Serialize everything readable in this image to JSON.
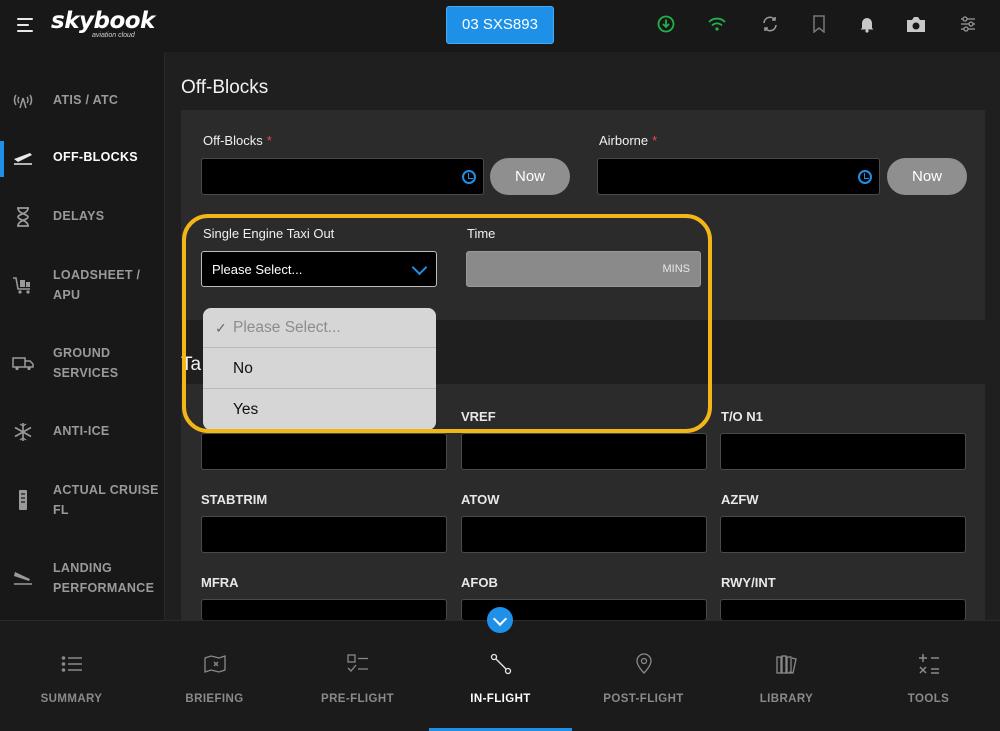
{
  "header": {
    "logo": "skybook",
    "logo_sub": "aviation cloud",
    "flight_id": "03 SXS893",
    "status_colors": {
      "download": "#22b04a",
      "wifi": "#22b04a"
    }
  },
  "sidebar": {
    "items": [
      {
        "label": "ATIS / ATC",
        "icon": "antenna-icon"
      },
      {
        "label": "OFF-BLOCKS",
        "icon": "takeoff-icon",
        "active": true
      },
      {
        "label": "DELAYS",
        "icon": "hourglass-icon"
      },
      {
        "label": "LOADSHEET / APU",
        "icon": "cart-icon"
      },
      {
        "label": "GROUND SERVICES",
        "icon": "truck-icon"
      },
      {
        "label": "ANTI-ICE",
        "icon": "snowflake-icon"
      },
      {
        "label": "ACTUAL CRUISE FL",
        "icon": "gauge-icon"
      },
      {
        "label": "LANDING PERFORMANCE",
        "icon": "landing-icon"
      }
    ]
  },
  "main": {
    "title": "Off-Blocks",
    "off_blocks": {
      "label": "Off-Blocks",
      "required": "*",
      "value": "",
      "now_label": "Now"
    },
    "airborne": {
      "label": "Airborne",
      "required": "*",
      "value": "",
      "now_label": "Now"
    },
    "taxi_out": {
      "label": "Single Engine Taxi Out",
      "value": "Please Select..."
    },
    "time": {
      "label": "Time",
      "unit": "MINS",
      "value": ""
    },
    "dropdown": {
      "options": [
        {
          "label": "Please Select...",
          "selected": true
        },
        {
          "label": "No"
        },
        {
          "label": "Yes"
        }
      ]
    },
    "section2_title": "Ta",
    "grid": [
      {
        "label": "",
        "value": ""
      },
      {
        "label": "VREF",
        "value": ""
      },
      {
        "label": "T/O N1",
        "value": ""
      },
      {
        "label": "STABTRIM",
        "value": ""
      },
      {
        "label": "ATOW",
        "value": ""
      },
      {
        "label": "AZFW",
        "value": ""
      },
      {
        "label": "MFRA",
        "value": ""
      },
      {
        "label": "AFOB",
        "value": ""
      },
      {
        "label": "RWY/INT",
        "value": ""
      }
    ]
  },
  "bottom_nav": {
    "items": [
      {
        "label": "SUMMARY",
        "icon": "list-icon"
      },
      {
        "label": "BRIEFING",
        "icon": "map-icon"
      },
      {
        "label": "PRE-FLIGHT",
        "icon": "checklist-icon"
      },
      {
        "label": "IN-FLIGHT",
        "icon": "route-icon",
        "active": true
      },
      {
        "label": "POST-FLIGHT",
        "icon": "location-pin-icon"
      },
      {
        "label": "LIBRARY",
        "icon": "books-icon"
      },
      {
        "label": "TOOLS",
        "icon": "calculator-icon"
      }
    ]
  },
  "accent_color": "#1e90e8",
  "highlight_color": "#f3b619"
}
